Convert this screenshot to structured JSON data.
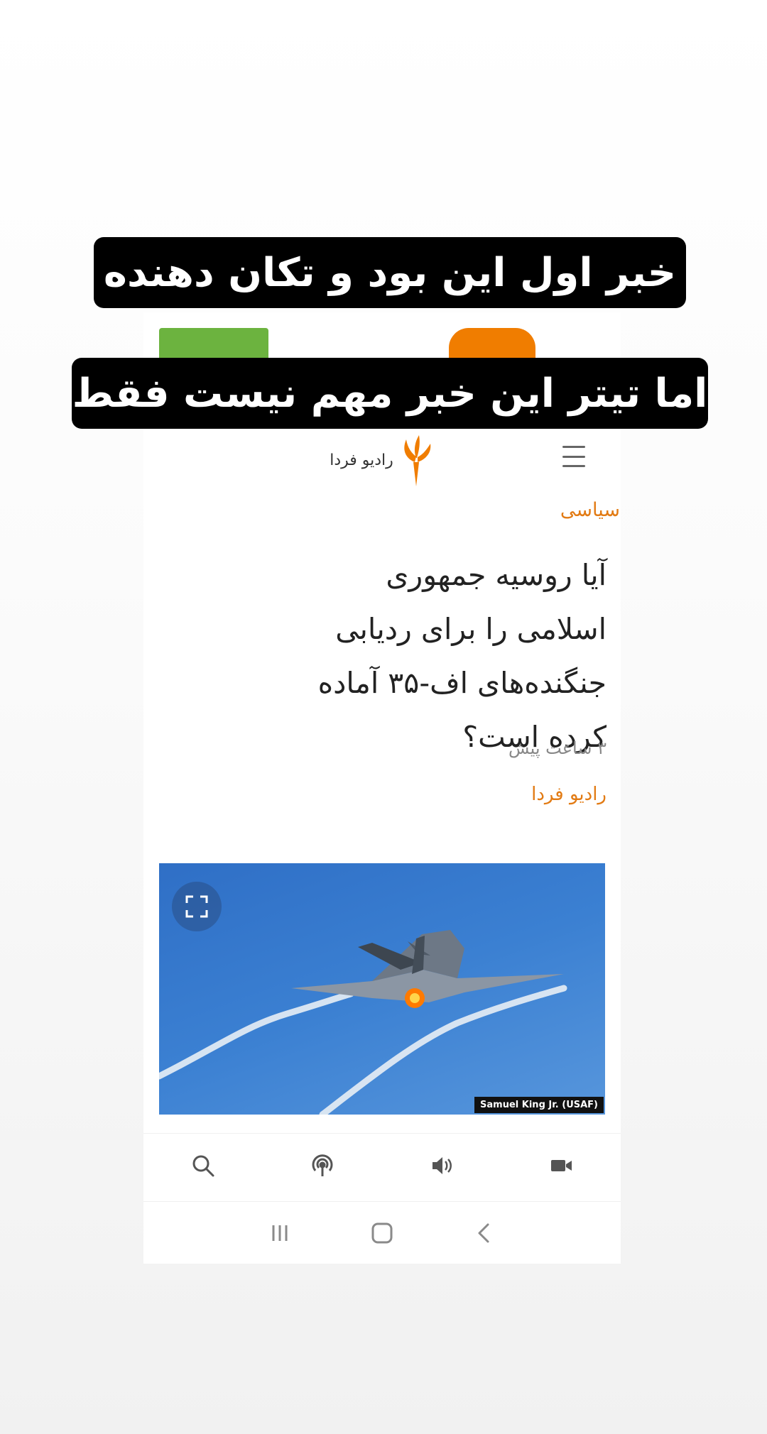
{
  "overlay": {
    "line1": "خبر اول این بود و تکان دهنده",
    "line2": "اما تیتر این خبر مهم نیست فقط"
  },
  "header": {
    "logo_text": "رادیو فردا",
    "menu_icon": "hamburger-icon",
    "logo_icon": "torch-logo-icon"
  },
  "article": {
    "category": "سیاسی",
    "headline": "آیا روسیه جمهوری اسلامی را برای ردیابی جنگنده‌های اف-۳۵ آماده کرده است؟",
    "time": "۳ ساعت پیش",
    "source": "رادیو فردا",
    "image": {
      "credit": "Samuel King Jr. (USAF)",
      "expand_icon": "expand-icon"
    }
  },
  "bottom_nav": {
    "icons": [
      "search-icon",
      "podcast-icon",
      "audio-icon",
      "video-icon"
    ]
  },
  "system_nav": {
    "icons": [
      "recent-apps-icon",
      "home-icon",
      "back-icon"
    ]
  },
  "colors": {
    "accent": "#e27b14",
    "banner_bg": "#000000",
    "green_tab": "#6cb33f",
    "orange_tab": "#f07d00"
  }
}
